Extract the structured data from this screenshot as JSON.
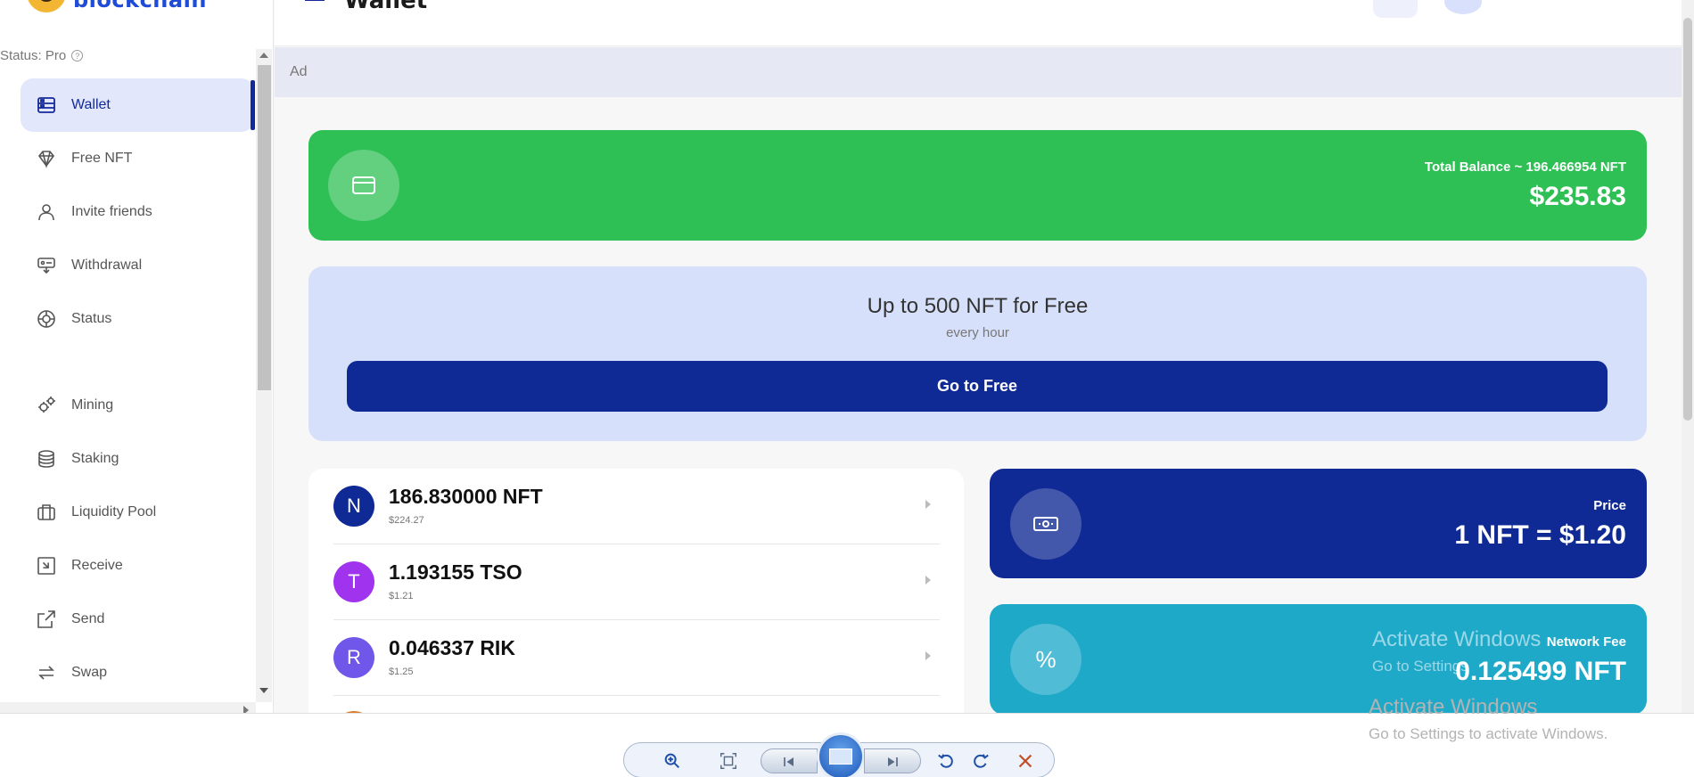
{
  "app": {
    "logo_text": "blockchain",
    "page_title": "Wallet"
  },
  "sidebar": {
    "status_text": "Status: Pro",
    "status_help_glyph": "?",
    "items": [
      {
        "label": "Wallet",
        "icon": "wallet-icon",
        "active": true
      },
      {
        "label": "Free NFT",
        "icon": "diamond-icon"
      },
      {
        "label": "Invite friends",
        "icon": "user-icon"
      },
      {
        "label": "Withdrawal",
        "icon": "withdrawal-icon"
      },
      {
        "label": "Status",
        "icon": "status-icon"
      },
      {
        "label": "Mining",
        "icon": "gears-icon"
      },
      {
        "label": "Staking",
        "icon": "coins-icon"
      },
      {
        "label": "Liquidity Pool",
        "icon": "briefcase-icon"
      },
      {
        "label": "Receive",
        "icon": "receive-icon"
      },
      {
        "label": "Send",
        "icon": "send-icon"
      },
      {
        "label": "Swap",
        "icon": "swap-icon"
      }
    ]
  },
  "ad": {
    "label": "Ad"
  },
  "balance": {
    "label": "Total Balance ~ 196.466954 NFT",
    "value": "$235.83",
    "color": "#2ec055"
  },
  "promo": {
    "title": "Up to 500 NFT for Free",
    "subtitle": "every hour",
    "button": "Go to Free"
  },
  "assets": [
    {
      "letter": "N",
      "amount": "186.830000 NFT",
      "usd": "$224.27",
      "color": "#0f2a94"
    },
    {
      "letter": "T",
      "amount": "1.193155 TSO",
      "usd": "$1.21",
      "color": "#a033ee"
    },
    {
      "letter": "R",
      "amount": "0.046337 RIK",
      "usd": "$1.25",
      "color": "#7057ea"
    }
  ],
  "price": {
    "label": "Price",
    "value": "1 NFT = $1.20",
    "color": "#0f2a94"
  },
  "fee": {
    "label": "Network Fee",
    "value": "0.125499 NFT",
    "symbol": "%",
    "color": "#1fa9c9"
  },
  "watermark": {
    "title": "Activate Windows",
    "subtitle": "Go to Settings to activate Windows.",
    "subtitle_short": "Go to Settings"
  }
}
